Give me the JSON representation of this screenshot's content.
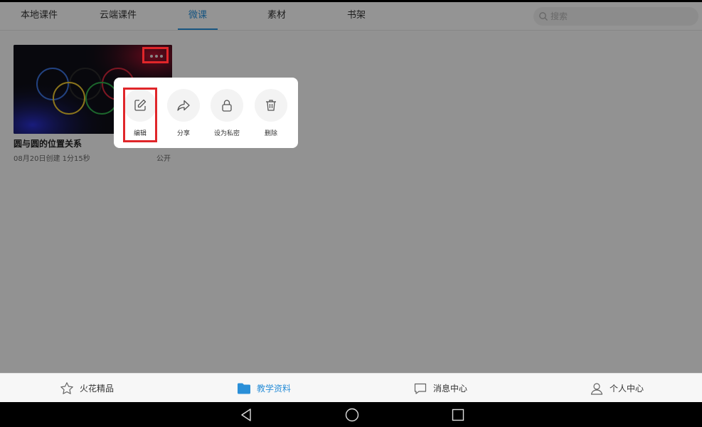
{
  "tabs": [
    {
      "label": "本地课件"
    },
    {
      "label": "云端课件"
    },
    {
      "label": "微课",
      "active": true
    },
    {
      "label": "素材"
    },
    {
      "label": "书架"
    }
  ],
  "search": {
    "placeholder": "搜索"
  },
  "course": {
    "title": "圆与圆的位置关系",
    "meta": "08月20日创建  1分15秒",
    "visibility": "公开"
  },
  "popup": {
    "actions": [
      {
        "label": "编辑",
        "icon": "edit-icon"
      },
      {
        "label": "分享",
        "icon": "share-icon"
      },
      {
        "label": "设为私密",
        "icon": "lock-icon"
      },
      {
        "label": "删除",
        "icon": "trash-icon"
      }
    ]
  },
  "bottom_nav": [
    {
      "label": "火花精品",
      "icon": "star-icon"
    },
    {
      "label": "教学资料",
      "icon": "folder-icon",
      "active": true
    },
    {
      "label": "消息中心",
      "icon": "message-icon"
    },
    {
      "label": "个人中心",
      "icon": "user-icon"
    }
  ],
  "colors": {
    "accent": "#2a8fd8",
    "highlight": "#e0262a"
  }
}
